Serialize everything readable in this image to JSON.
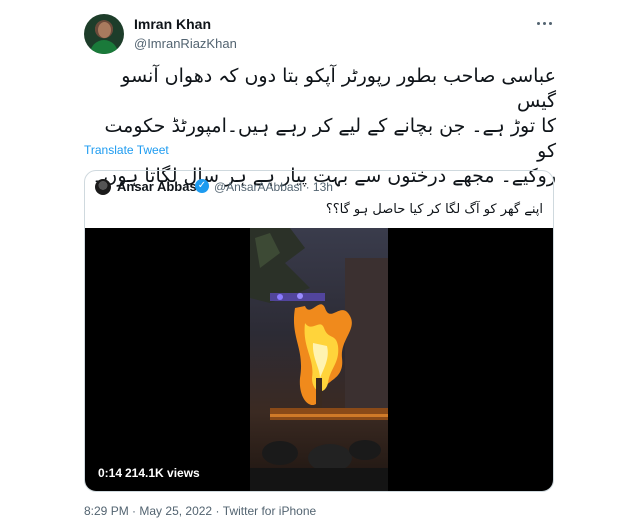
{
  "author": {
    "name": "Imran Khan",
    "handle": "@ImranRiazKhan"
  },
  "tweet": {
    "text_lines": [
      "عباسی صاحب بطور رپورٹر آپکو بتا دوں کہ دھواں آنسو گیس",
      "کا توڑ ہے۔ جن بچانے کے لیے کر رہے ہیں۔امپورٹڈ حکومت کو",
      "روکیے۔ مجھے درختوں سے بہت پیار ہے ہر سال لگاتا ہوں۔"
    ],
    "translate_label": "Translate Tweet"
  },
  "quoted": {
    "name": "Ansar Abbasi",
    "handle": "@AnsarAAbbasi",
    "separator": "·",
    "time": "13h",
    "text": "اپنے گھر کو آگ لگا کر کیا حاصل ہو گا؟؟",
    "video": {
      "duration": "0:14",
      "views": "214.1K views"
    }
  },
  "footer": {
    "time": "8:29 PM",
    "date": "May 25, 2022",
    "separator": "·",
    "source": "Twitter for iPhone"
  },
  "colors": {
    "link": "#1d9bf0",
    "muted": "#536471",
    "text": "#0f1419",
    "border": "#cfd9de"
  },
  "icons": {
    "more": "more-horizontal-icon",
    "verified": "verified-badge-icon"
  }
}
